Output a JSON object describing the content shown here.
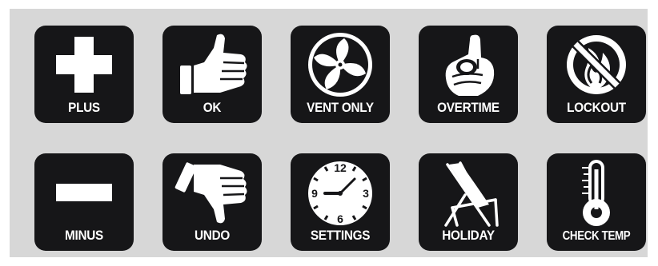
{
  "buttons": {
    "plus": {
      "label": "PLUS",
      "icon": "plus-icon"
    },
    "ok": {
      "label": "OK",
      "icon": "thumbs-up-icon"
    },
    "vent_only": {
      "label": "VENT ONLY",
      "icon": "fan-icon"
    },
    "overtime": {
      "label": "OVERTIME",
      "icon": "hand-pointing-icon"
    },
    "lockout": {
      "label": "LOCKOUT",
      "icon": "no-flame-icon"
    },
    "minus": {
      "label": "MINUS",
      "icon": "minus-icon"
    },
    "undo": {
      "label": "UNDO",
      "icon": "thumbs-down-icon"
    },
    "settings": {
      "label": "SETTINGS",
      "icon": "clock-icon",
      "clock_numbers": [
        "12",
        "3",
        "6",
        "9"
      ]
    },
    "holiday": {
      "label": "HOLIDAY",
      "icon": "deck-chair-icon"
    },
    "check_temp": {
      "label": "CHECK TEMP",
      "icon": "thermometer-icon"
    }
  },
  "colors": {
    "panel": "#d7d7d7",
    "button": "#161618",
    "foreground": "#ffffff"
  }
}
